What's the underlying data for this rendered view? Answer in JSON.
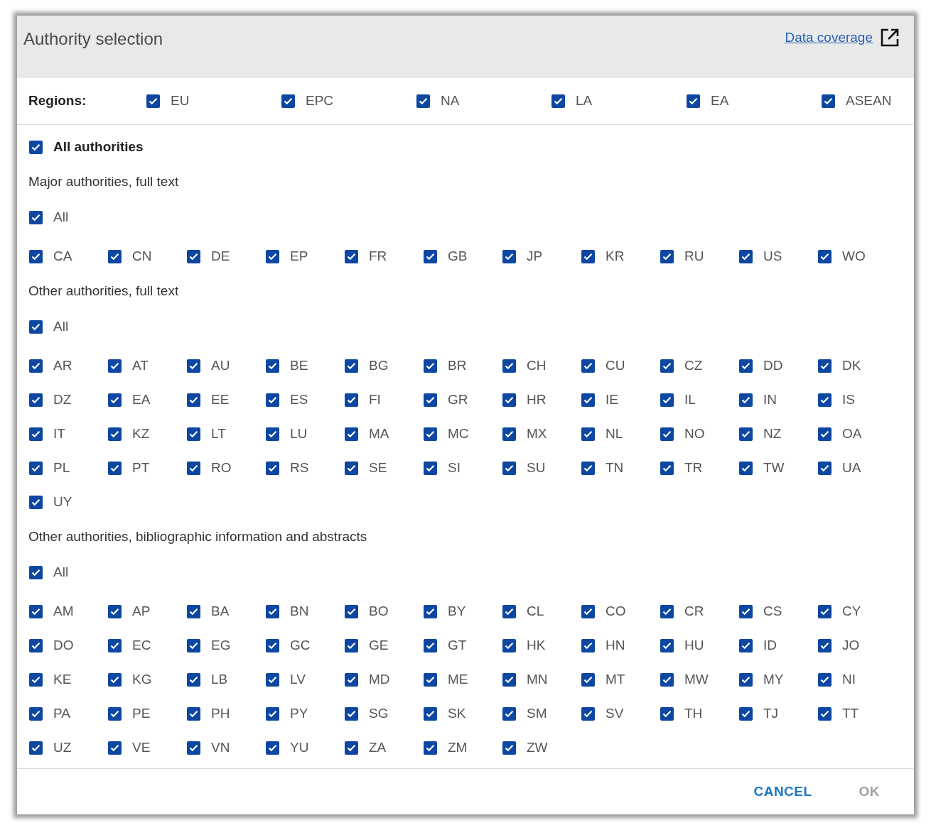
{
  "dialog": {
    "title": "Authority selection",
    "link": "Data coverage"
  },
  "regions": {
    "label": "Regions:",
    "items": [
      {
        "label": "EU",
        "checked": true
      },
      {
        "label": "EPC",
        "checked": true
      },
      {
        "label": "NA",
        "checked": true
      },
      {
        "label": "LA",
        "checked": true
      },
      {
        "label": "EA",
        "checked": true
      },
      {
        "label": "ASEAN",
        "checked": true
      }
    ]
  },
  "all_authorities": {
    "label": "All authorities",
    "checked": true
  },
  "sections": [
    {
      "title": "Major authorities, full text",
      "all": {
        "label": "All",
        "checked": true
      },
      "codes": [
        {
          "label": "CA",
          "checked": true
        },
        {
          "label": "CN",
          "checked": true
        },
        {
          "label": "DE",
          "checked": true
        },
        {
          "label": "EP",
          "checked": true
        },
        {
          "label": "FR",
          "checked": true
        },
        {
          "label": "GB",
          "checked": true
        },
        {
          "label": "JP",
          "checked": true
        },
        {
          "label": "KR",
          "checked": true
        },
        {
          "label": "RU",
          "checked": true
        },
        {
          "label": "US",
          "checked": true
        },
        {
          "label": "WO",
          "checked": true
        }
      ]
    },
    {
      "title": "Other authorities, full text",
      "all": {
        "label": "All",
        "checked": true
      },
      "codes": [
        {
          "label": "AR",
          "checked": true
        },
        {
          "label": "AT",
          "checked": true
        },
        {
          "label": "AU",
          "checked": true
        },
        {
          "label": "BE",
          "checked": true
        },
        {
          "label": "BG",
          "checked": true
        },
        {
          "label": "BR",
          "checked": true
        },
        {
          "label": "CH",
          "checked": true
        },
        {
          "label": "CU",
          "checked": true
        },
        {
          "label": "CZ",
          "checked": true
        },
        {
          "label": "DD",
          "checked": true
        },
        {
          "label": "DK",
          "checked": true
        },
        {
          "label": "DZ",
          "checked": true
        },
        {
          "label": "EA",
          "checked": true
        },
        {
          "label": "EE",
          "checked": true
        },
        {
          "label": "ES",
          "checked": true
        },
        {
          "label": "FI",
          "checked": true
        },
        {
          "label": "GR",
          "checked": true
        },
        {
          "label": "HR",
          "checked": true
        },
        {
          "label": "IE",
          "checked": true
        },
        {
          "label": "IL",
          "checked": true
        },
        {
          "label": "IN",
          "checked": true
        },
        {
          "label": "IS",
          "checked": true
        },
        {
          "label": "IT",
          "checked": true
        },
        {
          "label": "KZ",
          "checked": true
        },
        {
          "label": "LT",
          "checked": true
        },
        {
          "label": "LU",
          "checked": true
        },
        {
          "label": "MA",
          "checked": true
        },
        {
          "label": "MC",
          "checked": true
        },
        {
          "label": "MX",
          "checked": true
        },
        {
          "label": "NL",
          "checked": true
        },
        {
          "label": "NO",
          "checked": true
        },
        {
          "label": "NZ",
          "checked": true
        },
        {
          "label": "OA",
          "checked": true
        },
        {
          "label": "PL",
          "checked": true
        },
        {
          "label": "PT",
          "checked": true
        },
        {
          "label": "RO",
          "checked": true
        },
        {
          "label": "RS",
          "checked": true
        },
        {
          "label": "SE",
          "checked": true
        },
        {
          "label": "SI",
          "checked": true
        },
        {
          "label": "SU",
          "checked": true
        },
        {
          "label": "TN",
          "checked": true
        },
        {
          "label": "TR",
          "checked": true
        },
        {
          "label": "TW",
          "checked": true
        },
        {
          "label": "UA",
          "checked": true
        },
        {
          "label": "UY",
          "checked": true
        }
      ]
    },
    {
      "title": "Other authorities, bibliographic information and abstracts",
      "all": {
        "label": "All",
        "checked": true
      },
      "codes": [
        {
          "label": "AM",
          "checked": true
        },
        {
          "label": "AP",
          "checked": true
        },
        {
          "label": "BA",
          "checked": true
        },
        {
          "label": "BN",
          "checked": true
        },
        {
          "label": "BO",
          "checked": true
        },
        {
          "label": "BY",
          "checked": true
        },
        {
          "label": "CL",
          "checked": true
        },
        {
          "label": "CO",
          "checked": true
        },
        {
          "label": "CR",
          "checked": true
        },
        {
          "label": "CS",
          "checked": true
        },
        {
          "label": "CY",
          "checked": true
        },
        {
          "label": "DO",
          "checked": true
        },
        {
          "label": "EC",
          "checked": true
        },
        {
          "label": "EG",
          "checked": true
        },
        {
          "label": "GC",
          "checked": true
        },
        {
          "label": "GE",
          "checked": true
        },
        {
          "label": "GT",
          "checked": true
        },
        {
          "label": "HK",
          "checked": true
        },
        {
          "label": "HN",
          "checked": true
        },
        {
          "label": "HU",
          "checked": true
        },
        {
          "label": "ID",
          "checked": true
        },
        {
          "label": "JO",
          "checked": true
        },
        {
          "label": "KE",
          "checked": true
        },
        {
          "label": "KG",
          "checked": true
        },
        {
          "label": "LB",
          "checked": true
        },
        {
          "label": "LV",
          "checked": true
        },
        {
          "label": "MD",
          "checked": true
        },
        {
          "label": "ME",
          "checked": true
        },
        {
          "label": "MN",
          "checked": true
        },
        {
          "label": "MT",
          "checked": true
        },
        {
          "label": "MW",
          "checked": true
        },
        {
          "label": "MY",
          "checked": true
        },
        {
          "label": "NI",
          "checked": true
        },
        {
          "label": "PA",
          "checked": true
        },
        {
          "label": "PE",
          "checked": true
        },
        {
          "label": "PH",
          "checked": true
        },
        {
          "label": "PY",
          "checked": true
        },
        {
          "label": "SG",
          "checked": true
        },
        {
          "label": "SK",
          "checked": true
        },
        {
          "label": "SM",
          "checked": true
        },
        {
          "label": "SV",
          "checked": true
        },
        {
          "label": "TH",
          "checked": true
        },
        {
          "label": "TJ",
          "checked": true
        },
        {
          "label": "TT",
          "checked": true
        },
        {
          "label": "UZ",
          "checked": true
        },
        {
          "label": "VE",
          "checked": true
        },
        {
          "label": "VN",
          "checked": true
        },
        {
          "label": "YU",
          "checked": true
        },
        {
          "label": "ZA",
          "checked": true
        },
        {
          "label": "ZM",
          "checked": true
        },
        {
          "label": "ZW",
          "checked": true
        }
      ]
    }
  ],
  "buttons": [
    {
      "label": "CANCEL",
      "disabled": false
    },
    {
      "label": "OK",
      "disabled": true
    }
  ]
}
